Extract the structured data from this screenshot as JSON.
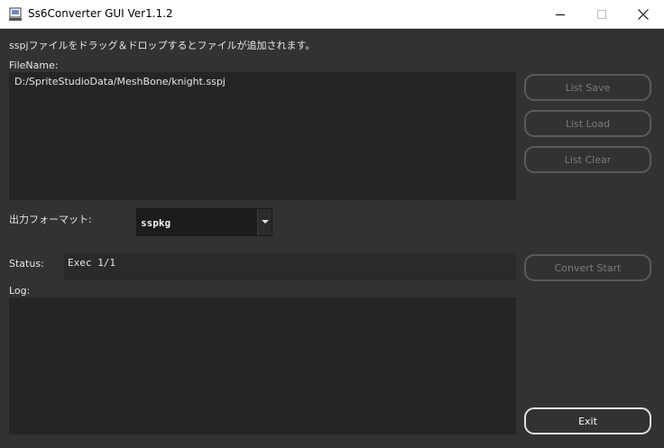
{
  "window": {
    "title": "Ss6Converter GUI Ver1.1.2",
    "app_icon": "app-icon",
    "controls": {
      "minimize": "minimize-icon",
      "maximize": "maximize-icon",
      "close": "close-icon"
    }
  },
  "hint": "sspjファイルをドラッグ＆ドロップするとファイルが追加されます。",
  "file_list": {
    "label": "FileName:",
    "items": [
      "D:/SpriteStudioData/MeshBone/knight.sspj"
    ]
  },
  "format": {
    "label": "出力フォーマット:",
    "selected": "sspkg"
  },
  "status": {
    "label": "Status:",
    "value": "Exec 1/1"
  },
  "log": {
    "label": "Log:"
  },
  "buttons": {
    "list_save": "List Save",
    "list_load": "List Load",
    "list_clear": "List Clear",
    "convert_start": "Convert Start",
    "exit": "Exit"
  }
}
